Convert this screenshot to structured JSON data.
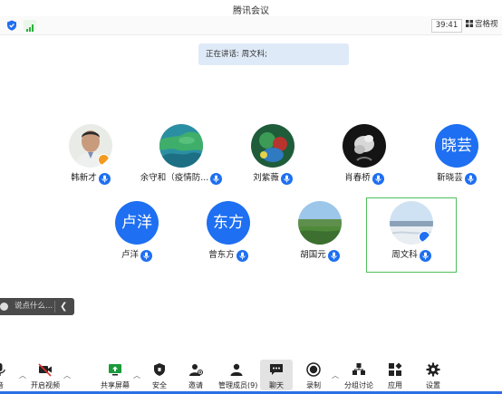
{
  "window": {
    "title": "腾讯会议"
  },
  "status": {
    "timer": "39:41",
    "gallery_label": "宫格视"
  },
  "speaking": {
    "text": "正在讲话: 周文科;"
  },
  "participants": [
    {
      "name": "韩新才"
    },
    {
      "name": "余守和（疫情防..."
    },
    {
      "name": "刘紫薇"
    },
    {
      "name": "肖春桥"
    },
    {
      "name": "靳晓芸",
      "avatar_text": "晓芸"
    },
    {
      "name": "卢洋",
      "avatar_text": "卢洋"
    },
    {
      "name": "曾东方",
      "avatar_text": "东方"
    },
    {
      "name": "胡国元"
    },
    {
      "name": "周文科"
    }
  ],
  "chat": {
    "placeholder": "说点什么..."
  },
  "toolbar": {
    "audio_label": "音",
    "video_label": "开启视频",
    "share_label": "共享屏幕",
    "security_label": "安全",
    "invite_label": "邀请",
    "members_label": "管理成员(9)",
    "chat_label": "聊天",
    "record_label": "录制",
    "breakout_label": "分组讨论",
    "apps_label": "应用",
    "settings_label": "设置"
  },
  "colors": {
    "accent": "#1e6ff1",
    "active_border": "#4fbf5c",
    "speaking_bg": "#dfeaf8",
    "host_badge": "#f39a1f"
  }
}
